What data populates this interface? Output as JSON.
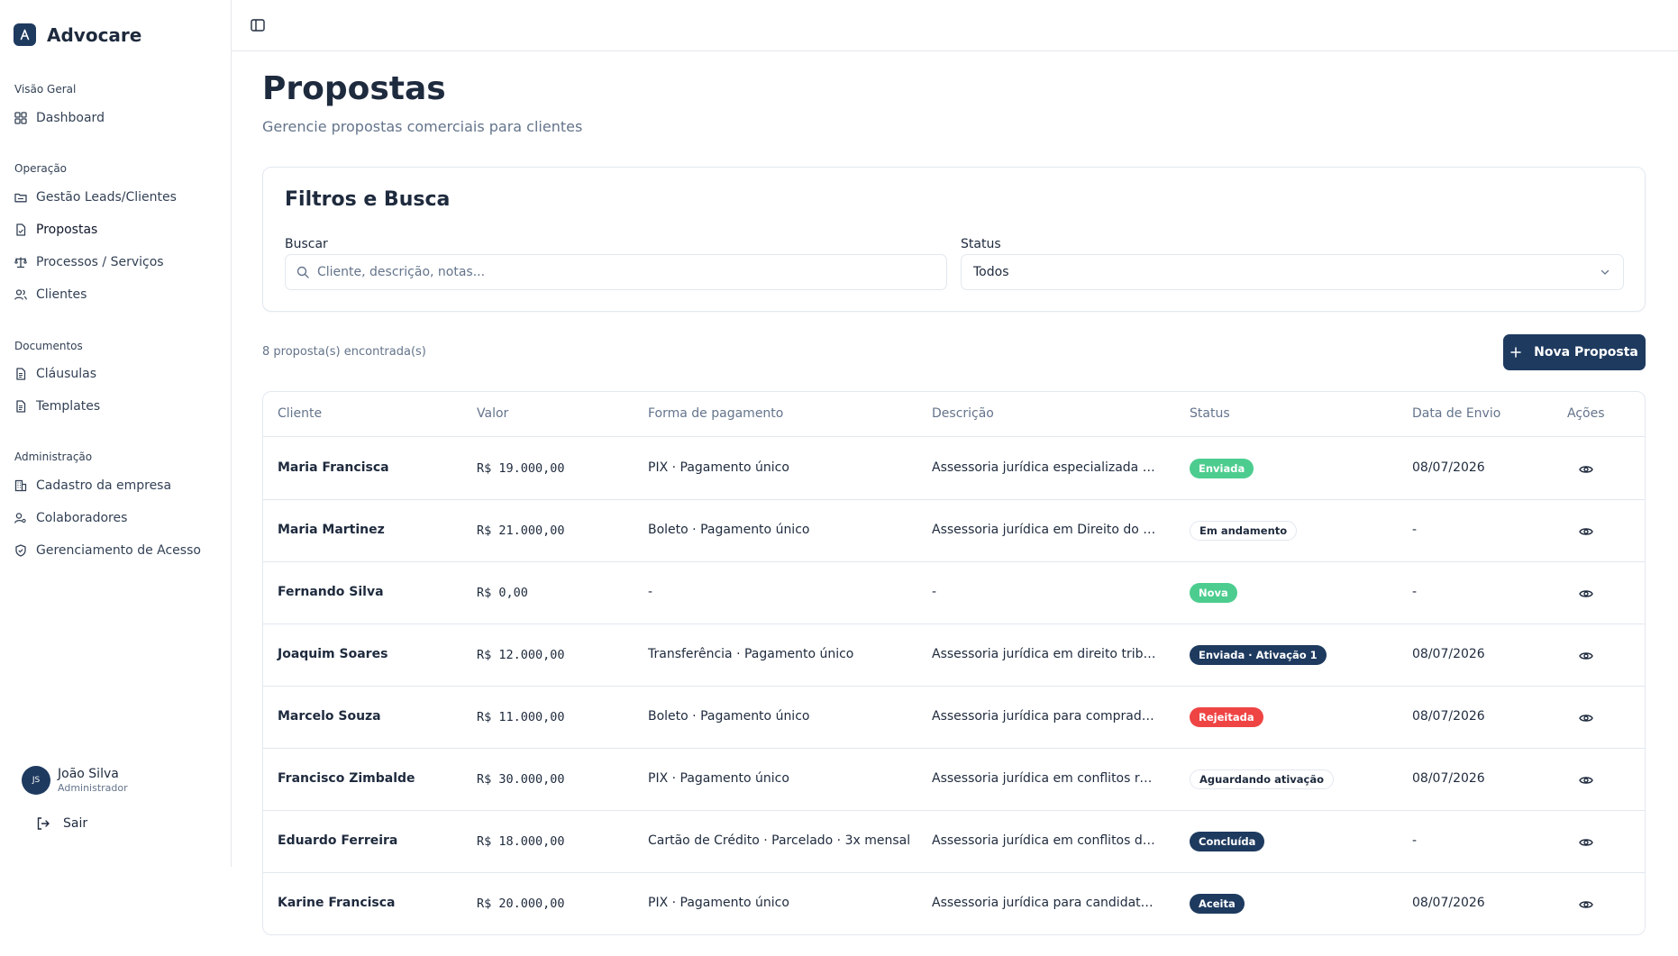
{
  "brand": {
    "name": "Advocare"
  },
  "sidebar": {
    "sections": [
      {
        "label": "Visão Geral",
        "items": [
          {
            "label": "Dashboard",
            "icon": "grid-icon"
          }
        ]
      },
      {
        "label": "Operação",
        "items": [
          {
            "label": "Gestão Leads/Clientes",
            "icon": "folder-icon"
          },
          {
            "label": "Propostas",
            "icon": "file-icon",
            "active": true
          },
          {
            "label": "Processos / Serviços",
            "icon": "scale-icon"
          },
          {
            "label": "Clientes",
            "icon": "users-icon"
          }
        ]
      },
      {
        "label": "Documentos",
        "items": [
          {
            "label": "Cláusulas",
            "icon": "document-icon"
          },
          {
            "label": "Templates",
            "icon": "document-icon"
          }
        ]
      },
      {
        "label": "Administração",
        "items": [
          {
            "label": "Cadastro da empresa",
            "icon": "building-icon"
          },
          {
            "label": "Colaboradores",
            "icon": "user-key-icon"
          },
          {
            "label": "Gerenciamento de Acesso",
            "icon": "shield-icon"
          }
        ]
      }
    ],
    "user": {
      "initials": "JS",
      "name": "João Silva",
      "role": "Administrador"
    },
    "logout_label": "Sair"
  },
  "page": {
    "title": "Propostas",
    "subtitle": "Gerencie propostas comerciais para clientes"
  },
  "filters": {
    "title": "Filtros e Busca",
    "search_label": "Buscar",
    "search_placeholder": "Cliente, descrição, notas...",
    "status_label": "Status",
    "status_value": "Todos"
  },
  "results": {
    "count_text": "8 proposta(s) encontrada(s)",
    "new_button": "Nova Proposta"
  },
  "table": {
    "columns": [
      "Cliente",
      "Valor",
      "Forma de pagamento",
      "Descrição",
      "Status",
      "Data de Envio",
      "Ações"
    ],
    "rows": [
      {
        "cliente": "Maria Francisca",
        "valor": "R$ 19.000,00",
        "pagamento": "PIX · Pagamento único",
        "descricao": "Assessoria jurídica especializada em c...",
        "status": "Enviada",
        "status_style": "green",
        "data": "08/07/2026"
      },
      {
        "cliente": "Maria Martinez",
        "valor": "R$ 21.000,00",
        "pagamento": "Boleto · Pagamento único",
        "descricao": "Assessoria jurídica em Direito do Trab...",
        "status": "Em andamento",
        "status_style": "outline",
        "data": "-"
      },
      {
        "cliente": "Fernando Silva",
        "valor": "R$ 0,00",
        "pagamento": "-",
        "descricao": "-",
        "status": "Nova",
        "status_style": "green",
        "data": "-"
      },
      {
        "cliente": "Joaquim Soares",
        "valor": "R$ 12.000,00",
        "pagamento": "Transferência · Pagamento único",
        "descricao": "Assessoria jurídica em direito tributári...",
        "status": "Enviada · Ativação 1",
        "status_style": "navy",
        "data": "08/07/2026"
      },
      {
        "cliente": "Marcelo Souza",
        "valor": "R$ 11.000,00",
        "pagamento": "Boleto · Pagamento único",
        "descricao": "Assessoria jurídica para compradores ...",
        "status": "Rejeitada",
        "status_style": "red",
        "data": "08/07/2026"
      },
      {
        "cliente": "Francisco Zimbalde",
        "valor": "R$ 30.000,00",
        "pagamento": "PIX · Pagamento único",
        "descricao": "Assessoria jurídica em conflitos relaci...",
        "status": "Aguardando ativação",
        "status_style": "outline",
        "data": "08/07/2026"
      },
      {
        "cliente": "Eduardo Ferreira",
        "valor": "R$ 18.000,00",
        "pagamento": "Cartão de Crédito · Parcelado · 3x mensal",
        "descricao": "Assessoria jurídica em conflitos decorr...",
        "status": "Concluída",
        "status_style": "navy",
        "data": "-"
      },
      {
        "cliente": "Karine Francisca",
        "valor": "R$ 20.000,00",
        "pagamento": "PIX · Pagamento único",
        "descricao": "Assessoria jurídica para candidatos ap...",
        "status": "Aceita",
        "status_style": "navy",
        "data": "08/07/2026"
      }
    ]
  },
  "colors": {
    "primary": "#1e3a5f",
    "badge_green": "#4ccd8f",
    "badge_red": "#ef4444",
    "badge_navy": "#1e3a5f",
    "muted_text": "#64748b",
    "border": "#e2e8f0"
  }
}
